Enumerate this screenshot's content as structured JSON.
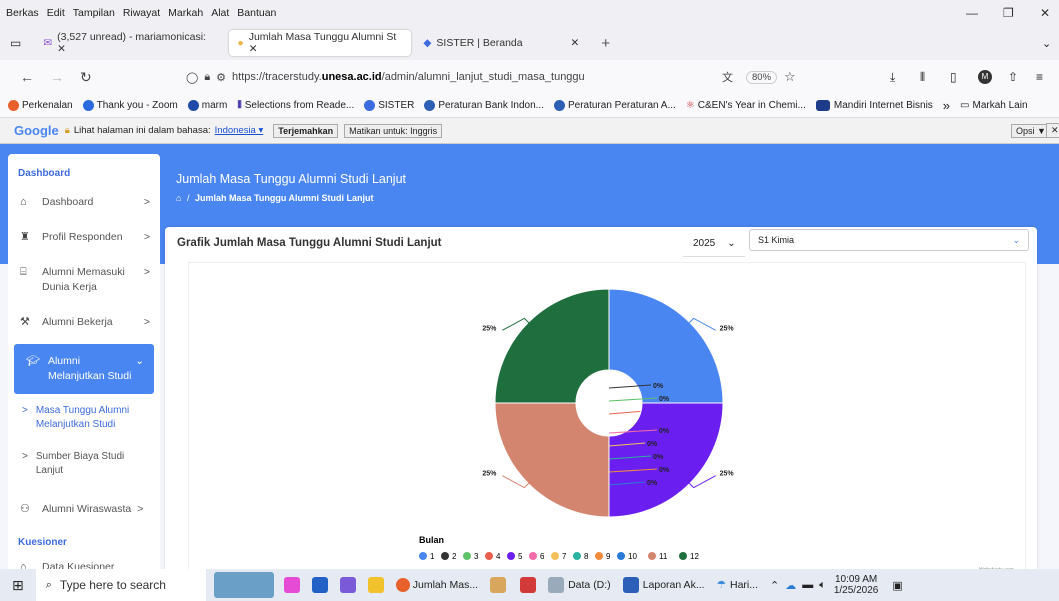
{
  "menubar": [
    "Berkas",
    "Edit",
    "Tampilan",
    "Riwayat",
    "Markah",
    "Alat",
    "Bantuan"
  ],
  "tabs": [
    {
      "label": "(3,527 unread) - mariamonicasi: ✕",
      "icon": "mail-icon"
    },
    {
      "label": "Jumlah Masa Tunggu Alumni St ✕",
      "icon": "site-icon"
    },
    {
      "label": "SISTER | Beranda",
      "icon": "sister-icon"
    }
  ],
  "tab_close": "✕",
  "new_tab": "+",
  "url_prefix": "https://tracerstudy.",
  "url_domain": "unesa.ac.id",
  "url_path": "/admin/alumni_lanjut_studi_masa_tunggu",
  "zoom": "80%",
  "bookmarks": [
    "Perkenalan",
    "Thank you - Zoom",
    "marm",
    "Selections from Reade...",
    "SISTER",
    "Peraturan Bank Indon...",
    "Peraturan Peraturan A...",
    "C&EN's Year in Chemi...",
    "Mandiri Internet Bisnis"
  ],
  "bookmark_more": "»",
  "bookmark_folder": "Markah Lain",
  "translate": {
    "google": "Google",
    "text": "Lihat halaman ini dalam bahasa:",
    "lang": "Indonesia ▾",
    "btn1": "Terjemahkan",
    "btn2": "Matikan untuk: Inggris",
    "opsi": "Opsi ▼",
    "close": "✕"
  },
  "sidebar": {
    "head1": "Dashboard",
    "items": [
      {
        "label": "Dashboard",
        "icon": "home-icon",
        "chev": ">"
      },
      {
        "label": "Profil Responden",
        "icon": "user-icon",
        "chev": ">"
      },
      {
        "label": "Alumni Memasuki Dunia Kerja",
        "icon": "building-icon",
        "chev": ">"
      },
      {
        "label": "Alumni Bekerja",
        "icon": "worker-icon",
        "chev": ">"
      }
    ],
    "active": "Alumni Melanjutkan Studi",
    "active_chev": "⌄",
    "subs": [
      "Masa Tunggu Alumni Melanjutkan Studi",
      "Sumber Biaya Studi Lanjut"
    ],
    "sub_bullet": ">",
    "wiraswasta": "Alumni Wiraswasta",
    "wiraswasta_chev": ">",
    "head2": "Kuesioner",
    "data_kuesioner": "Data Kuesioner"
  },
  "page": {
    "title": "Jumlah Masa Tunggu Alumni Studi Lanjut",
    "crumb": "Jumlah Masa Tunggu Alumni Studi Lanjut",
    "crumb_sep": "/",
    "card_title": "Grafik Jumlah Masa Tunggu Alumni Studi Lanjut",
    "year": "2025",
    "year_chev": "⌄",
    "prodi": "S1 Kimia",
    "prodi_chev": "⌄"
  },
  "chart_data": {
    "type": "pie",
    "donut": true,
    "legend_title": "Bulan",
    "legend_position": "bottom",
    "labels": [
      "1",
      "2",
      "3",
      "4",
      "5",
      "6",
      "7",
      "8",
      "9",
      "10",
      "11",
      "12"
    ],
    "values": [
      25,
      0,
      0,
      0,
      25,
      0,
      0,
      0,
      0,
      0,
      25,
      25
    ],
    "data_labels": [
      "25%",
      "0%",
      "0%",
      "0%",
      "25%",
      "0%",
      "0%",
      "0%",
      "0%",
      "0%",
      "25%",
      "25%"
    ],
    "colors": [
      "#4a86f2",
      "#333333",
      "#5ec26a",
      "#e8604c",
      "#6a1ff0",
      "#f06ba8",
      "#f6c15c",
      "#2bb3a0",
      "#f08a3c",
      "#2a7bd6",
      "#d4856f",
      "#1f6e3e"
    ],
    "credit": "Highcharts.com"
  },
  "taskbar": {
    "search": "Type here to search",
    "apps": [
      "Jumlah Mas...",
      "Data (D:)",
      "Laporan Ak...",
      "Hari..."
    ],
    "time": "10:09 AM",
    "date": "1/25/2026"
  }
}
